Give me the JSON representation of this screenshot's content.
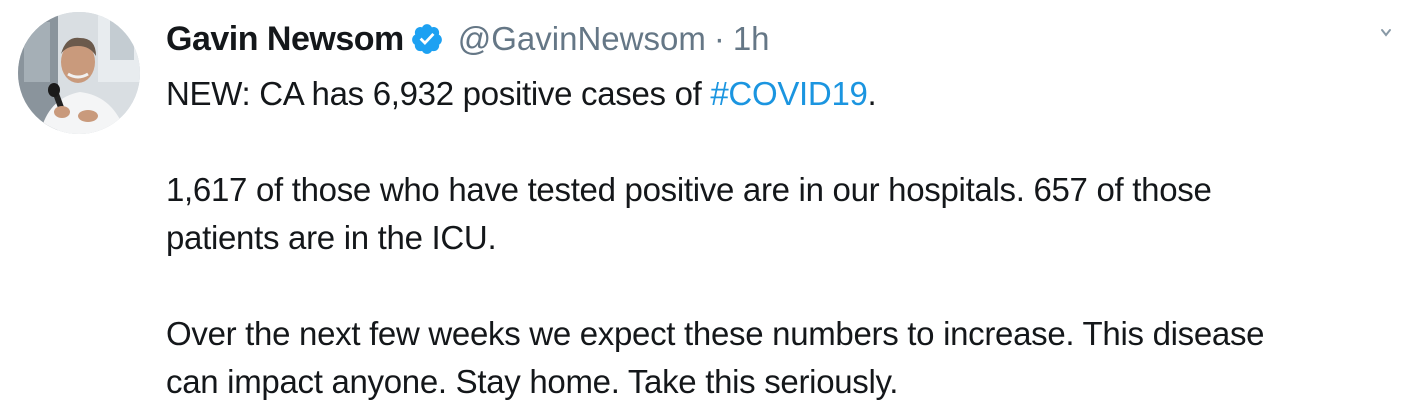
{
  "tweet": {
    "display_name": "Gavin Newsom",
    "handle": "@GavinNewsom",
    "separator": "·",
    "time": "1h",
    "verified_icon": "verified-badge-icon",
    "caret_icon": "chevron-down-icon",
    "text": {
      "p1_prefix": "NEW: CA has 6,932 positive cases of ",
      "p1_hashtag": "#COVID19",
      "p1_suffix": ".",
      "p2_line1": "1,617 of those who have tested positive are in our hospitals. 657 of those",
      "p2_line2": "patients are in the ICU.",
      "p3_line1": "Over the next few weeks we expect these numbers to increase. This disease",
      "p3_line2": "can impact anyone. Stay home. Take this seriously."
    }
  },
  "colors": {
    "text": "#14171a",
    "secondary": "#657786",
    "link": "#1b95e0",
    "verified": "#1da1f2"
  }
}
